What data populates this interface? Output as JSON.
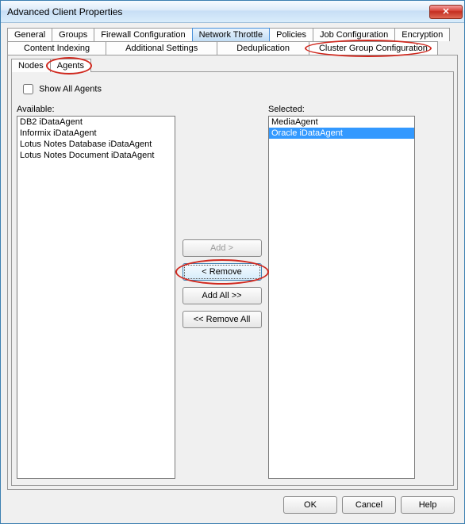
{
  "window": {
    "title": "Advanced Client Properties"
  },
  "tabs_row1": [
    {
      "label": "General"
    },
    {
      "label": "Groups"
    },
    {
      "label": "Firewall Configuration"
    },
    {
      "label": "Network Throttle"
    },
    {
      "label": "Policies"
    },
    {
      "label": "Job Configuration"
    },
    {
      "label": "Encryption"
    }
  ],
  "tabs_row2": [
    {
      "label": "Content Indexing"
    },
    {
      "label": "Additional Settings"
    },
    {
      "label": "Deduplication"
    },
    {
      "label": "Cluster Group Configuration"
    }
  ],
  "inner_tabs": [
    {
      "label": "Nodes"
    },
    {
      "label": "Agents"
    }
  ],
  "show_all": {
    "label": "Show All Agents",
    "checked": false
  },
  "available": {
    "label": "Available:",
    "items": [
      "DB2 iDataAgent",
      "Informix iDataAgent",
      "Lotus Notes Database iDataAgent",
      "Lotus Notes Document iDataAgent"
    ]
  },
  "selected": {
    "label": "Selected:",
    "items": [
      {
        "text": "MediaAgent",
        "selected": false
      },
      {
        "text": "Oracle iDataAgent",
        "selected": true
      }
    ]
  },
  "buttons": {
    "add": "Add >",
    "remove": "< Remove",
    "add_all": "Add All >>",
    "remove_all": "<< Remove All"
  },
  "dialog_buttons": {
    "ok": "OK",
    "cancel": "Cancel",
    "help": "Help"
  }
}
